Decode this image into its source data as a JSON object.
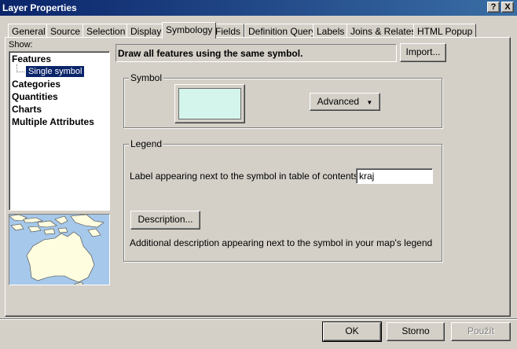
{
  "window": {
    "title": "Layer Properties",
    "help_btn": "?",
    "close_btn": "X"
  },
  "tabs": [
    {
      "label": "General"
    },
    {
      "label": "Source"
    },
    {
      "label": "Selection"
    },
    {
      "label": "Display"
    },
    {
      "label": "Symbology",
      "active": true
    },
    {
      "label": "Fields"
    },
    {
      "label": "Definition Query"
    },
    {
      "label": "Labels"
    },
    {
      "label": "Joins & Relates"
    },
    {
      "label": "HTML Popup"
    }
  ],
  "show": {
    "label": "Show:",
    "items": [
      {
        "label": "Features"
      },
      {
        "label": "Single symbol",
        "child": true,
        "selected": true
      },
      {
        "label": "Categories"
      },
      {
        "label": "Quantities"
      },
      {
        "label": "Charts"
      },
      {
        "label": "Multiple Attributes"
      }
    ]
  },
  "symbology": {
    "description": "Draw all features using the same symbol.",
    "import_label": "Import...",
    "symbol_group": "Symbol",
    "symbol_color": "#d4f5ec",
    "advanced_label": "Advanced",
    "legend_group": "Legend",
    "label_caption": "Label appearing next to the symbol in table of contents:",
    "label_value": "kraj",
    "description_btn": "Description...",
    "description_note": "Additional description appearing next to the symbol in your map's legend"
  },
  "footer": {
    "ok": "OK",
    "cancel": "Storno",
    "apply": "Použít"
  },
  "colors": {
    "titlebar": "#0a246a",
    "face": "#d4d0c8",
    "selection": "#0a246a",
    "map_sea": "#a6c8ea",
    "map_land": "#fffde0"
  }
}
